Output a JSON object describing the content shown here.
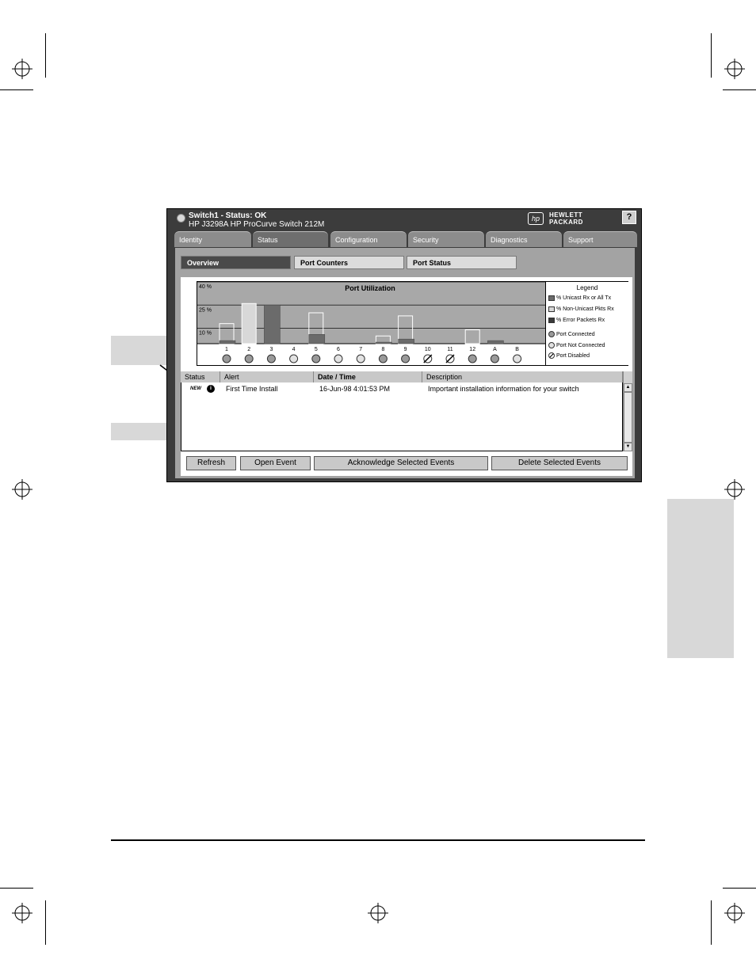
{
  "window": {
    "title_line1": "Switch1 - Status: OK",
    "title_line2": "HP J3298A HP ProCurve Switch 212M",
    "logo_badge": "hp",
    "logo_line1": "HEWLETT",
    "logo_line2": "PACKARD",
    "help_label": "?"
  },
  "tabs": [
    {
      "label": "Identity"
    },
    {
      "label": "Status"
    },
    {
      "label": "Configuration"
    },
    {
      "label": "Security"
    },
    {
      "label": "Diagnostics"
    },
    {
      "label": "Support"
    }
  ],
  "subtabs": [
    {
      "label": "Overview"
    },
    {
      "label": "Port Counters"
    },
    {
      "label": "Port Status"
    }
  ],
  "chart_data": {
    "type": "bar",
    "title": "Port Utilization",
    "ytick_labels": [
      "40 %",
      "25 %",
      "10 %"
    ],
    "ylim": [
      0,
      40
    ],
    "categories": [
      "1",
      "2",
      "3",
      "4",
      "5",
      "6",
      "7",
      "8",
      "9",
      "10",
      "11",
      "12",
      "A",
      "B"
    ],
    "series": [
      {
        "name": "% Unicast Rx or All Tx",
        "values": [
          2,
          0,
          25,
          0,
          6,
          0,
          0,
          1,
          3,
          0,
          0,
          0,
          2,
          0
        ]
      },
      {
        "name": "% Non-Unicast Pkts Rx",
        "values": [
          13,
          26,
          0,
          0,
          20,
          0,
          0,
          5,
          18,
          0,
          0,
          9,
          0,
          0
        ]
      },
      {
        "name": "% Error Packets Rx",
        "values": [
          0,
          0,
          0,
          0,
          0,
          0,
          0,
          0,
          0,
          0,
          0,
          0,
          0,
          0
        ]
      }
    ],
    "port_states": [
      "connected",
      "connected",
      "connected",
      "not-connected",
      "connected",
      "not-connected",
      "not-connected",
      "connected",
      "connected",
      "disabled",
      "disabled",
      "connected",
      "connected",
      "not-connected"
    ],
    "legend_title": "Legend",
    "legend_status": [
      "Port Connected",
      "Port Not Connected",
      "Port Disabled"
    ],
    "colors": {
      "unicast": "#6b6b6b",
      "nonunicast": "#d8d8d8",
      "error": "#3a3a3a",
      "plot_bg": "#a8a8a8"
    }
  },
  "table": {
    "headers": [
      "Status",
      "Alert",
      "Date / Time",
      "Description"
    ],
    "rows": [
      {
        "badge": "NEW",
        "alert": "First Time Install",
        "datetime": "16-Jun-98 4:01:53 PM",
        "description": "Important installation information for your switch"
      }
    ]
  },
  "buttons": {
    "refresh": "Refresh",
    "open_event": "Open Event",
    "acknowledge": "Acknowledge Selected Events",
    "delete": "Delete Selected Events"
  }
}
